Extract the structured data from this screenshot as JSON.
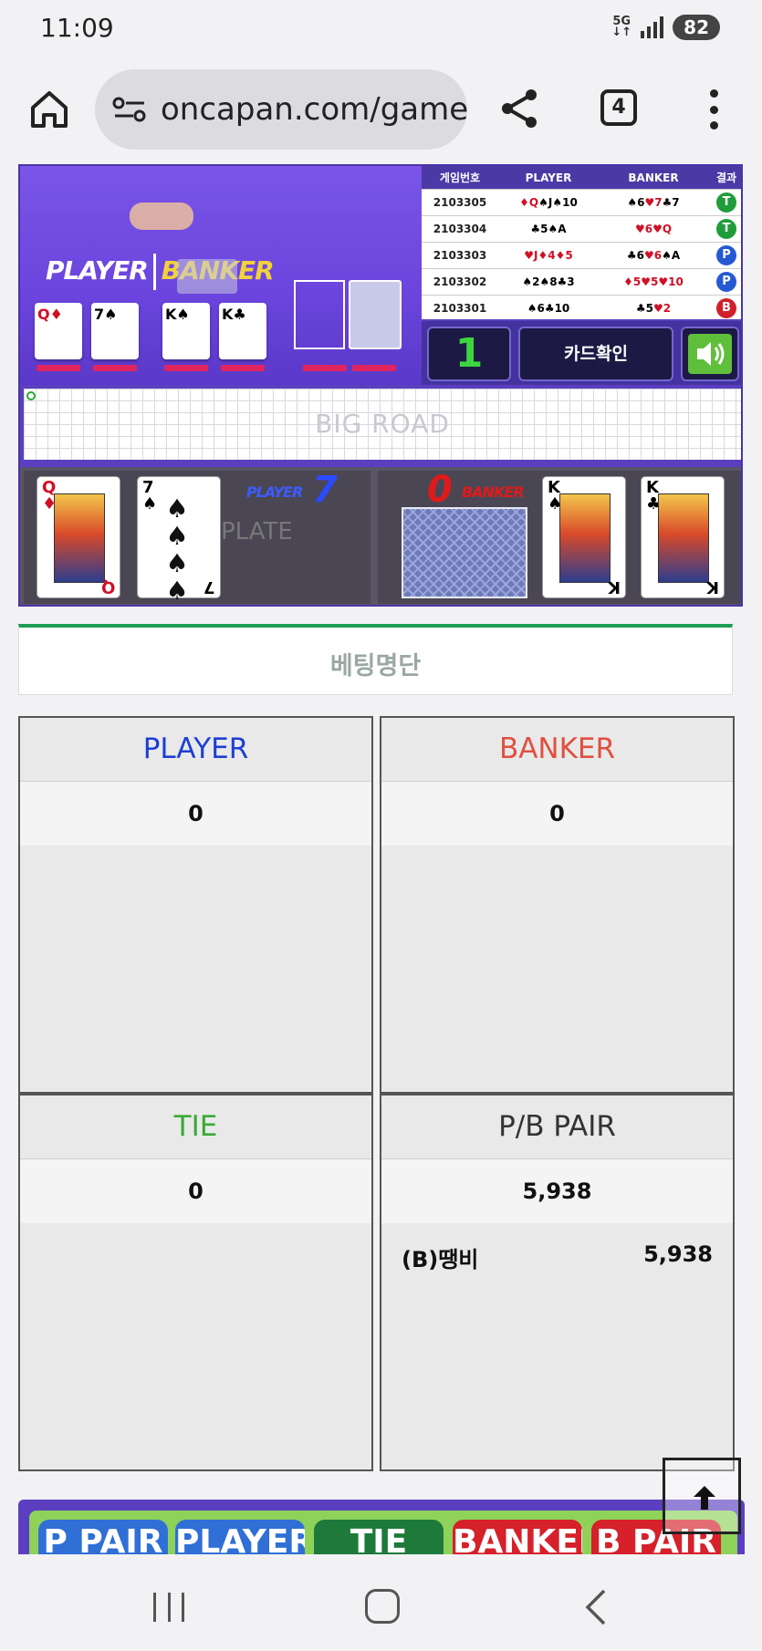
{
  "status_bar": {
    "time": "11:09",
    "network": "5G",
    "battery": "82"
  },
  "browser": {
    "url": "oncapan.com/gamez",
    "tab_count": "4"
  },
  "video": {
    "player_label": "PLAYER",
    "banker_label": "BANKER"
  },
  "history": {
    "headers": [
      "게임번호",
      "PLAYER",
      "BANKER",
      "결과"
    ],
    "rows": [
      {
        "game": "2103305",
        "player": "♦Q♠J♠10",
        "banker": "♠6♥7♣7",
        "result": "T"
      },
      {
        "game": "2103304",
        "player": "♣5♠A",
        "banker": "♥6♥Q",
        "result": "T"
      },
      {
        "game": "2103303",
        "player": "♥J♦4♦5",
        "banker": "♣6♥6♠A",
        "result": "P"
      },
      {
        "game": "2103302",
        "player": "♠2♠8♣3",
        "banker": "♦5♥5♥10",
        "result": "P"
      },
      {
        "game": "2103301",
        "player": "♠6♣10",
        "banker": "♣5♥2",
        "result": "B"
      }
    ]
  },
  "controls": {
    "round": "1",
    "card_check": "카드확인"
  },
  "big_road": {
    "label": "BIG ROAD"
  },
  "cards": {
    "player_label": "PLAYER",
    "player_score": "7",
    "banker_label": "BANKER",
    "banker_score": "0",
    "watermark": "PLATE",
    "player_cards": [
      {
        "rank": "Q",
        "suit": "♦"
      },
      {
        "rank": "7",
        "suit": "♠"
      }
    ],
    "banker_cards": [
      {
        "rank": "K",
        "suit": "♠"
      },
      {
        "rank": "K",
        "suit": "♣"
      }
    ]
  },
  "bet_list": {
    "title": "베팅명단"
  },
  "bets": {
    "player": {
      "title": "PLAYER",
      "total": "0",
      "color": "#1d3fd3"
    },
    "banker": {
      "title": "BANKER",
      "total": "0",
      "color": "#e05040"
    },
    "tie": {
      "title": "TIE",
      "total": "0",
      "color": "#3aaa35"
    },
    "pb_pair": {
      "title": "P/B PAIR",
      "total": "5,938",
      "color": "#333333",
      "entries": [
        {
          "name": "(B)땡비",
          "amount": "5,938"
        }
      ]
    }
  },
  "bet_buttons": [
    "P PAIR",
    "PLAYER",
    "TIE",
    "BANKER",
    "B PAIR"
  ]
}
